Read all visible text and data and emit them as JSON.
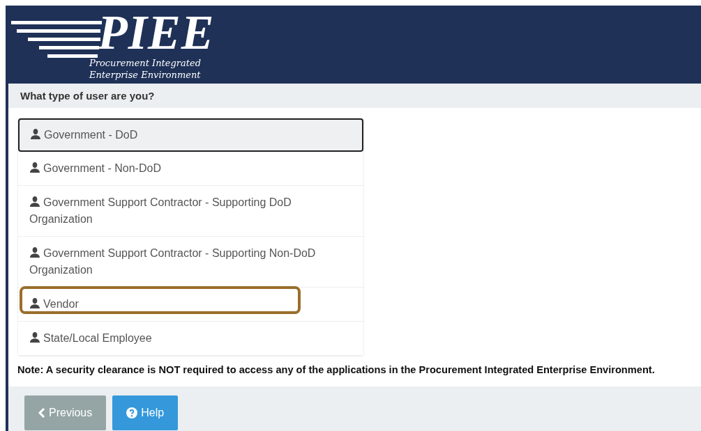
{
  "header": {
    "logo_text": "PIEE",
    "subtitle_lines": [
      "Procurement Integrated",
      "Enterprise Environment"
    ]
  },
  "question": "What type of user are you?",
  "user_types": [
    {
      "label": "Government - DoD",
      "focused": true,
      "highlighted": false
    },
    {
      "label": "Government - Non-DoD",
      "focused": false,
      "highlighted": false
    },
    {
      "label": "Government Support Contractor - Supporting DoD Organization",
      "focused": false,
      "highlighted": false
    },
    {
      "label": "Government Support Contractor - Supporting Non-DoD Organization",
      "focused": false,
      "highlighted": false
    },
    {
      "label": "Vendor",
      "focused": false,
      "highlighted": true
    },
    {
      "label": "State/Local Employee",
      "focused": false,
      "highlighted": false
    }
  ],
  "note": "Note: A security clearance is NOT required to access any of the applications in the Procurement Integrated Enterprise Environment.",
  "buttons": [
    {
      "label": "Previous",
      "kind": "previous"
    },
    {
      "label": "Help",
      "kind": "help"
    }
  ]
}
